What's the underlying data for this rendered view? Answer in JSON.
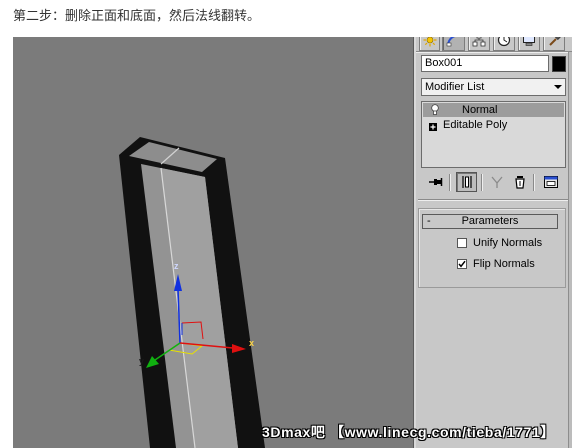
{
  "caption": "第二步：删除正面和底面，然后法线翻转。",
  "viewport": {
    "watermark": "3Dmax吧 【www.linecg.com/tieba/1771】",
    "axis_labels": {
      "x": "x",
      "y": "y",
      "z": "z"
    }
  },
  "command_panel": {
    "tabs": [
      {
        "icon": "create-icon",
        "active": false
      },
      {
        "icon": "modify-icon",
        "active": true
      },
      {
        "icon": "hierarchy-icon",
        "active": false
      },
      {
        "icon": "motion-icon",
        "active": false
      },
      {
        "icon": "display-icon",
        "active": false
      },
      {
        "icon": "utilities-icon",
        "active": false
      }
    ],
    "object_name": "Box001",
    "object_color": "#000000",
    "modifier_list": "Modifier List",
    "stack": [
      {
        "label": "Normal",
        "icon": "light-bulb-icon",
        "selected": true
      },
      {
        "label": "Editable Poly",
        "icon": "expand-plus-icon",
        "selected": false
      }
    ],
    "stack_tools": [
      "pin-stack-icon",
      "show-end-result-icon",
      "make-unique-icon",
      "remove-modifier-icon",
      "configure-modifier-sets-icon"
    ],
    "rollout": {
      "toggle": "-",
      "title": "Parameters",
      "options": [
        {
          "label": "Unify Normals",
          "checked": false
        },
        {
          "label": "Flip Normals",
          "checked": true
        }
      ]
    }
  },
  "colors": {
    "viewport_bg": "#7b7b7b",
    "panel_bg": "#c8c8c8",
    "stack_bg": "#d9d9d9",
    "selected_row": "#9c9c9c",
    "x_axis": "#e01010",
    "y_axis": "#10b010",
    "z_axis": "#1030e0",
    "gizmo_plane": "#e8e000"
  }
}
